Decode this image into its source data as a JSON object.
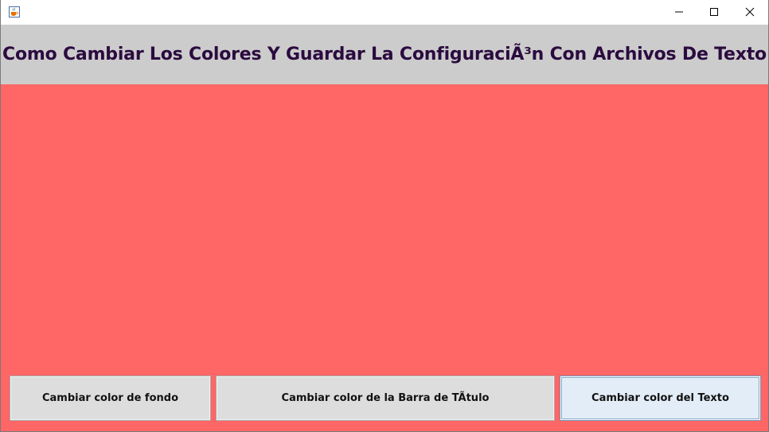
{
  "window": {
    "controls": {
      "minimize_icon": "minimize-icon",
      "maximize_icon": "maximize-icon",
      "close_icon": "close-icon"
    },
    "app_icon": "java-cup-icon"
  },
  "header": {
    "title": "Como Cambiar Los Colores Y Guardar La ConfiguraciÃ³n Con Archivos De Texto"
  },
  "buttons": {
    "background_label": "Cambiar color de fondo",
    "titlebar_label": "Cambiar color de la Barra de TÃ­tulo",
    "text_label": "Cambiar color del Texto"
  },
  "colors": {
    "content_background": "#ff6666",
    "header_background": "#cccccc",
    "title_text": "#2b0b3f",
    "button_background": "#dddddd",
    "focused_button_background": "#e3edf7"
  }
}
